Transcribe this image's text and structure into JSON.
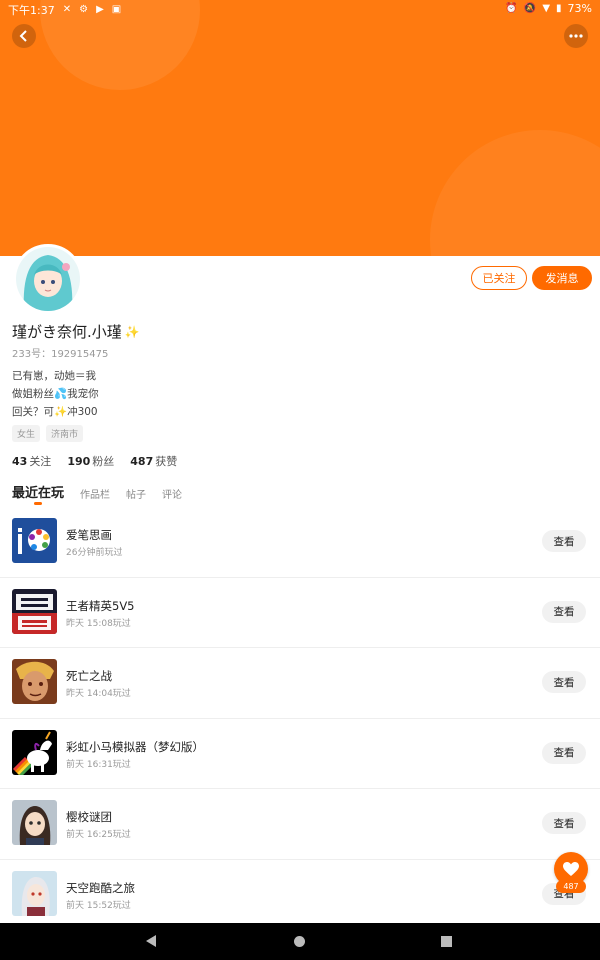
{
  "status_bar": {
    "time": "下午1:37",
    "battery": "73%",
    "icons_left": [
      "x-icon",
      "settings-icon",
      "play-icon",
      "clipboard-icon"
    ],
    "icons_right": [
      "alarm-icon",
      "mute-icon",
      "wifi-icon",
      "battery-icon"
    ]
  },
  "header": {
    "color": "#ff7a10"
  },
  "profile": {
    "name": "瑾がき奈何.小瑾",
    "name_emoji": "✨",
    "uid": "233号：192915475",
    "bio": [
      "已有崽，动她＝我",
      "做姐粉丝💦我宠你",
      "回关？可✨冲300"
    ],
    "tags": [
      "女生",
      "济南市"
    ],
    "stats": [
      {
        "num": "43",
        "label": "关注"
      },
      {
        "num": "190",
        "label": "粉丝"
      },
      {
        "num": "487",
        "label": "获赞"
      }
    ],
    "buttons": {
      "followed": "已关注",
      "message": "发消息"
    }
  },
  "tabs": [
    {
      "label": "最近在玩",
      "active": true
    },
    {
      "label": "作品栏",
      "active": false
    },
    {
      "label": "帖子",
      "active": false
    },
    {
      "label": "评论",
      "active": false
    }
  ],
  "games": [
    {
      "title": "爱笔思画",
      "subtitle": "26分钟前玩过",
      "button": "查看",
      "icon": "ibis-paint-icon"
    },
    {
      "title": "王者精英5V5",
      "subtitle": "昨天 15:08玩过",
      "button": "查看",
      "icon": "game-5v5-icon"
    },
    {
      "title": "死亡之战",
      "subtitle": "昨天 14:04玩过",
      "button": "查看",
      "icon": "hero-portrait-icon"
    },
    {
      "title": "彩虹小马模拟器（梦幻版）",
      "subtitle": "前天 16:31玩过",
      "button": "查看",
      "icon": "unicorn-icon"
    },
    {
      "title": "樱校谜团",
      "subtitle": "前天 16:25玩过",
      "button": "查看",
      "icon": "anime-girl-icon"
    },
    {
      "title": "天空跑酷之旅",
      "subtitle": "前天 15:52玩过",
      "button": "查看",
      "icon": "sky-parkour-icon"
    }
  ],
  "like": {
    "count": "487"
  },
  "colors": {
    "accent": "#ff6a00"
  }
}
